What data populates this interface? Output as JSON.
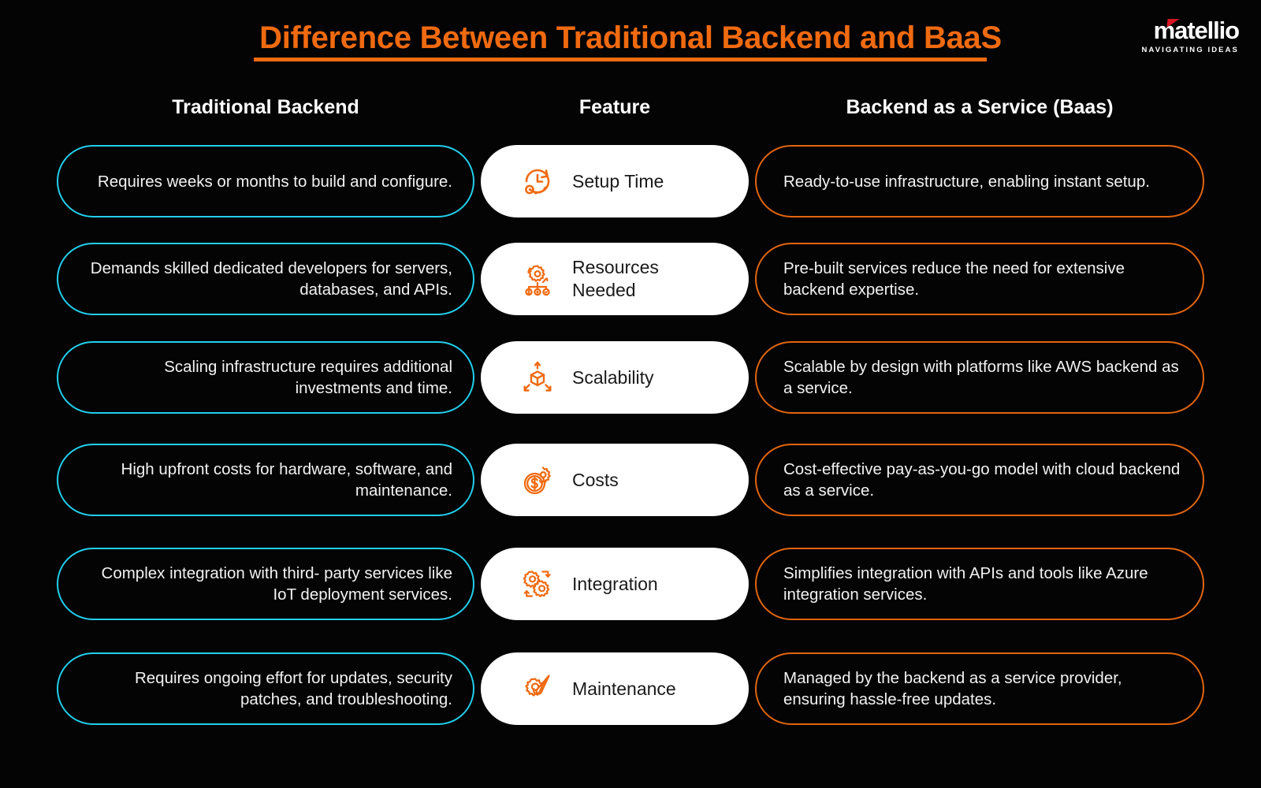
{
  "header": {
    "title": "Difference Between Traditional Backend and BaaS",
    "accent_color": "#F06A10"
  },
  "logo": {
    "name": "matellio",
    "tagline": "NAVIGATING IDEAS",
    "mark_color": "#D81824"
  },
  "columns": {
    "left": "Traditional Backend",
    "middle": "Feature",
    "right": "Backend as a Service (Baas)"
  },
  "colors": {
    "background": "#040404",
    "left_border": "#22CFEC",
    "right_border": "#E2650E",
    "feature_background": "#FFFFFF",
    "icon_color": "#F06A10",
    "text": "#F2F2F2"
  },
  "rows": [
    {
      "feature": "Setup Time",
      "icon": "clock-setup-icon",
      "traditional": "Requires weeks or months to build and configure.",
      "baas": "Ready-to-use infrastructure, enabling instant setup."
    },
    {
      "feature": "Resources\nNeeded",
      "icon": "gear-resources-icon",
      "traditional": "Demands skilled dedicated developers for servers, databases, and APIs.",
      "baas": "Pre-built services reduce the need for extensive backend expertise."
    },
    {
      "feature": "Scalability",
      "icon": "cube-scale-icon",
      "traditional": "Scaling infrastructure requires additional investments and time.",
      "baas": "Scalable by design with platforms like AWS backend as a service."
    },
    {
      "feature": "Costs",
      "icon": "coin-gear-icon",
      "traditional": "High upfront costs for hardware, software, and maintenance.",
      "baas": "Cost-effective pay-as-you-go model with cloud backend as a service."
    },
    {
      "feature": "Integration",
      "icon": "gears-sync-icon",
      "traditional": "Complex integration with third- party services like IoT deployment services.",
      "baas": "Simplifies integration with APIs and tools like Azure integration services."
    },
    {
      "feature": "Maintenance",
      "icon": "gear-wrench-icon",
      "traditional": "Requires ongoing effort for updates, security patches, and troubleshooting.",
      "baas": "Managed by the backend as a service provider, ensuring hassle-free updates."
    }
  ]
}
